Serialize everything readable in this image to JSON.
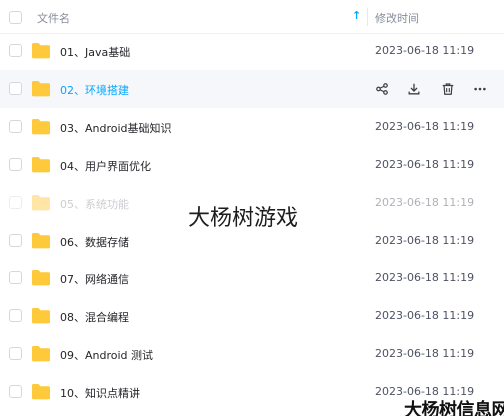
{
  "header": {
    "name_label": "文件名",
    "sort_arrow": "↑",
    "time_label": "修改时间"
  },
  "files": [
    {
      "name": "01、Java基础",
      "modified": "2023-06-18 11:19",
      "state": "normal"
    },
    {
      "name": "02、环境搭建",
      "modified": "",
      "state": "hover"
    },
    {
      "name": "03、Android基础知识",
      "modified": "2023-06-18 11:19",
      "state": "normal"
    },
    {
      "name": "04、用户界面优化",
      "modified": "2023-06-18 11:19",
      "state": "normal"
    },
    {
      "name": "05、系统功能",
      "modified": "2023-06-18 11:19",
      "state": "faded"
    },
    {
      "name": "06、数据存储",
      "modified": "2023-06-18 11:19",
      "state": "normal"
    },
    {
      "name": "07、网络通信",
      "modified": "2023-06-18 11:19",
      "state": "normal"
    },
    {
      "name": "08、混合编程",
      "modified": "2023-06-18 11:19",
      "state": "normal"
    },
    {
      "name": "09、Android 测试",
      "modified": "2023-06-18 11:19",
      "state": "normal"
    },
    {
      "name": "10、知识点精讲",
      "modified": "2023-06-18 11:19",
      "state": "normal"
    }
  ],
  "row_actions": [
    "share-icon",
    "download-icon",
    "delete-icon",
    "more-icon"
  ],
  "overlay": {
    "watermark": "大杨树游戏",
    "corner_mark": "大杨树信息网"
  },
  "colors": {
    "accent": "#06a7ff",
    "folder": "#ffc93c",
    "hover_row": "#f5f7fa"
  }
}
